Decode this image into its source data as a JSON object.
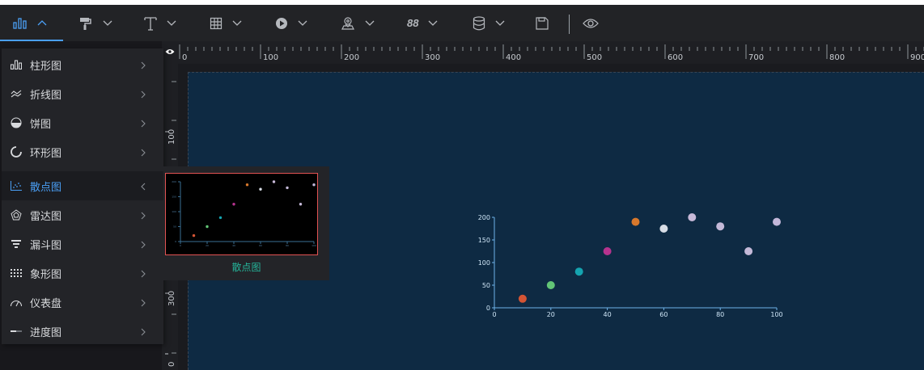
{
  "toolbar": {
    "buttons": [
      {
        "icon": "bar-chart-icon",
        "active": true
      },
      {
        "icon": "paint-roller-icon"
      },
      {
        "icon": "text-icon"
      },
      {
        "icon": "table-icon"
      },
      {
        "icon": "media-play-icon"
      },
      {
        "icon": "map-pin-icon"
      },
      {
        "icon": "number-icon",
        "text": "88"
      },
      {
        "icon": "database-icon"
      },
      {
        "icon": "save-icon"
      },
      {
        "icon": "eye-icon"
      }
    ]
  },
  "ruler": {
    "top_labels": [
      "0",
      "100",
      "200",
      "300",
      "400",
      "500",
      "600",
      "700",
      "800",
      "900"
    ],
    "left_labels": [
      "100",
      "300",
      "0"
    ]
  },
  "menu": {
    "items": [
      {
        "label": "柱形图",
        "icon": "bar-chart-icon"
      },
      {
        "label": "折线图",
        "icon": "line-chart-icon"
      },
      {
        "label": "饼图",
        "icon": "pie-chart-icon"
      },
      {
        "label": "环形图",
        "icon": "ring-chart-icon"
      },
      {
        "label": "散点图",
        "icon": "scatter-chart-icon",
        "active": true
      },
      {
        "label": "雷达图",
        "icon": "radar-chart-icon"
      },
      {
        "label": "漏斗图",
        "icon": "funnel-chart-icon"
      },
      {
        "label": "象形图",
        "icon": "pictorial-chart-icon"
      },
      {
        "label": "仪表盘",
        "icon": "gauge-icon"
      },
      {
        "label": "进度图",
        "icon": "progress-icon"
      }
    ]
  },
  "popover": {
    "thumb_label": "散点图"
  },
  "colors": {
    "accent": "#4a9ff5",
    "canvas": "#0e2a43",
    "thumb_label": "#25b59a"
  },
  "chart_data": {
    "type": "scatter",
    "x": [
      10,
      20,
      30,
      40,
      50,
      60,
      70,
      80,
      90,
      100
    ],
    "y": [
      20,
      50,
      80,
      125,
      190,
      175,
      200,
      180,
      125,
      190
    ],
    "point_colors": [
      "#d35434",
      "#62c576",
      "#15a4b0",
      "#b6338e",
      "#d7782c",
      "#d8dde6",
      "#c7b9d8",
      "#c4b9d8",
      "#c4b9d8",
      "#c2b7d9"
    ],
    "xlim": [
      0,
      100
    ],
    "ylim": [
      0,
      200
    ],
    "x_ticks": [
      "0",
      "20",
      "40",
      "60",
      "80",
      "100"
    ],
    "y_ticks": [
      "0",
      "50",
      "100",
      "150",
      "200"
    ],
    "grid": false
  }
}
